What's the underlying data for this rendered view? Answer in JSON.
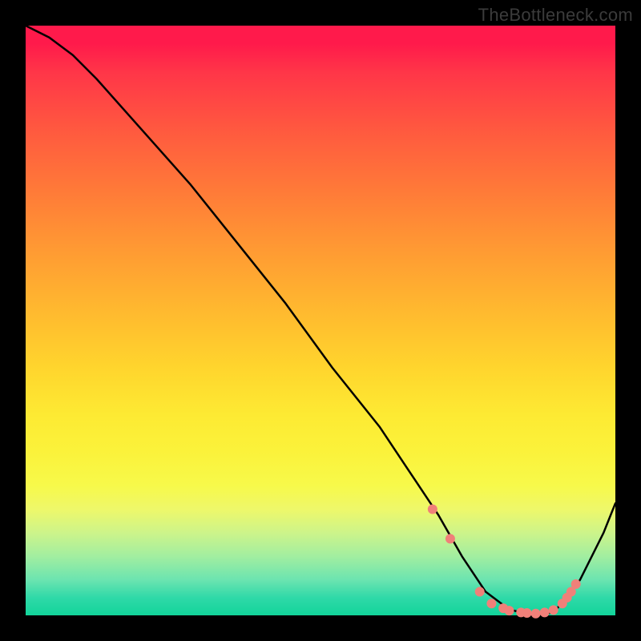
{
  "watermark": "TheBottleneck.com",
  "chart_data": {
    "type": "line",
    "title": "",
    "xlabel": "",
    "ylabel": "",
    "xlim": [
      0,
      100
    ],
    "ylim": [
      0,
      100
    ],
    "grid": false,
    "legend": false,
    "series": [
      {
        "name": "curve",
        "style": "line",
        "color": "#000000",
        "x": [
          0,
          4,
          8,
          12,
          20,
          28,
          36,
          44,
          52,
          60,
          66,
          70,
          74,
          78,
          82,
          86,
          88,
          90,
          94,
          98,
          100
        ],
        "values": [
          100,
          98,
          95,
          91,
          82,
          73,
          63,
          53,
          42,
          32,
          23,
          17,
          10,
          4,
          1,
          0,
          0,
          1,
          6,
          14,
          19
        ]
      },
      {
        "name": "dots",
        "style": "scatter",
        "color": "#f08079",
        "x": [
          69,
          72,
          77,
          79,
          81,
          82,
          84,
          85,
          86.5,
          88,
          89.5,
          91,
          91.8,
          92.5,
          93.3
        ],
        "values": [
          18,
          13,
          4,
          2,
          1.2,
          0.8,
          0.5,
          0.4,
          0.3,
          0.5,
          0.9,
          2.0,
          3.0,
          4.0,
          5.3
        ]
      }
    ]
  }
}
